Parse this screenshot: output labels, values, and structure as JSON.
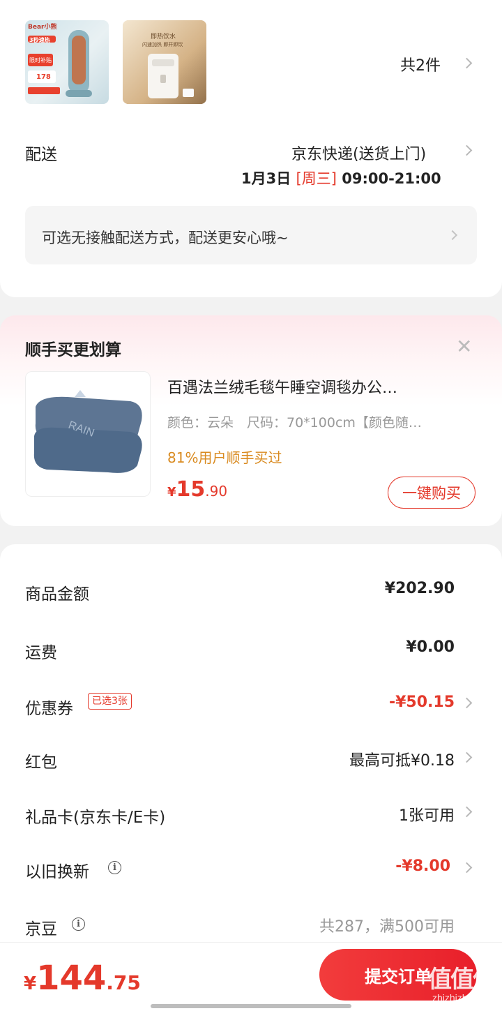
{
  "goods": {
    "thumb1": {
      "brand": "Bear小熊",
      "badge": "3秒速热",
      "promo1": "限时补贴",
      "price": "178"
    },
    "thumb2": {
      "caption1": "即热饮水",
      "caption2": "闪速加热 即开即饮"
    },
    "count_label": "共2件"
  },
  "delivery": {
    "label": "配送",
    "method": "京东快递(送货上门)",
    "date": "1月3日",
    "weekday": "[周三]",
    "time": "09:00-21:00",
    "notice": "可选无接触配送方式，配送更安心哦~"
  },
  "addon": {
    "title": "顺手买更划算",
    "close": "✕",
    "product": {
      "name": "百遇法兰绒毛毯午睡空调毯办公…",
      "spec": "颜色：云朵　尺码：70*100cm【颜色随…",
      "social": "81%用户顺手买过",
      "price_symbol": "¥",
      "price_int": "15",
      "price_dec": ".90",
      "buy_label": "一键购买"
    }
  },
  "summary": {
    "rows": [
      {
        "label": "商品金额",
        "value": "¥202.90"
      },
      {
        "label": "运费",
        "value": "¥0.00"
      },
      {
        "label": "优惠券",
        "tag": "已选3张",
        "value": "-¥50.15"
      },
      {
        "label": "红包",
        "value": "最高可抵¥0.18"
      },
      {
        "label": "礼品卡(京东卡/E卡)",
        "value": "1张可用"
      },
      {
        "label": "以旧换新",
        "value": "-¥8.00"
      },
      {
        "label": "京豆",
        "value": "共287，满500可用"
      }
    ]
  },
  "footer": {
    "price_symbol": "¥",
    "price_int": "144",
    "price_dec": ".75",
    "submit_label": "提交订单"
  },
  "watermark": {
    "glyphs": "值值值",
    "domain": "zhizhizhi.com"
  },
  "colors": {
    "accent": "#e4392b",
    "background": "#f2f2f2",
    "orange_text": "#d98a1f"
  }
}
